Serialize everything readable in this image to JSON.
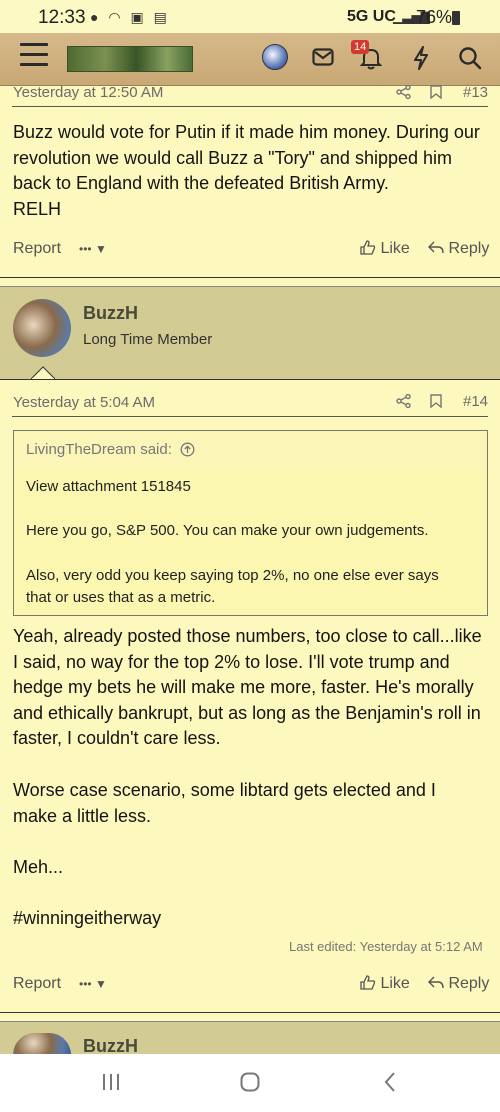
{
  "status_bar": {
    "time": "12:33",
    "network": "5G UC",
    "battery": "76%"
  },
  "header": {
    "notification_count": "14"
  },
  "post13": {
    "timestamp": "Yesterday at 12:50 AM",
    "number": "#13",
    "lines": [
      "Buzz would vote for Putin if it made him money. During our",
      "revolution we would call Buzz a \"Tory\" and shipped him",
      "back to England with the defeated British Army.",
      "RELH"
    ],
    "report_label": "Report",
    "more_label": "•••",
    "like_label": "Like",
    "reply_label": "Reply"
  },
  "post14": {
    "author": "BuzzH",
    "role": "Long Time Member",
    "timestamp": "Yesterday at 5:04 AM",
    "number": "#14",
    "quote": {
      "author_line": "LivingTheDream said:",
      "attachment": "View attachment 151845",
      "line1": "Here you go, S&P 500. You can make your own judgements.",
      "line2a": "Also, very odd you keep saying top 2%, no one else ever says",
      "line2b": "that or uses that as a metric."
    },
    "para1": [
      "Yeah, already posted those numbers, too close to call...like",
      "I said, no way for the top 2% to lose. I'll vote trump and",
      "hedge my bets he will make me more, faster. He's morally",
      "and ethically bankrupt, but as long as the Benjamin's roll in",
      "faster, I couldn't care less."
    ],
    "para2": [
      "Worse case scenario, some libtard gets elected and I",
      "make a little less."
    ],
    "para3": "Meh...",
    "para4": "#winningeitherway",
    "last_edited": "Last edited: Yesterday at 5:12 AM",
    "report_label": "Report",
    "more_label": "•••",
    "like_label": "Like",
    "reply_label": "Reply"
  },
  "post15": {
    "author": "BuzzH"
  }
}
